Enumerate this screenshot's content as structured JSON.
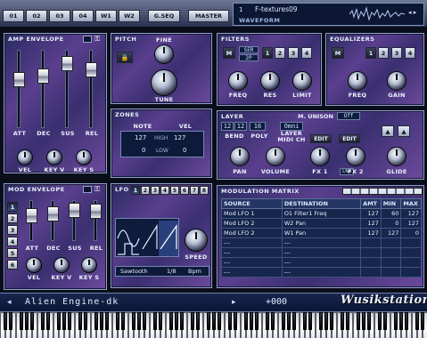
{
  "top_tabs": [
    "01",
    "02",
    "03",
    "04",
    "W1",
    "W2"
  ],
  "gseq_label": "G.SEQ",
  "master_label": "MASTER",
  "waveform": {
    "index": "1",
    "name": "F-textures09",
    "label": "WAVEFORM"
  },
  "amp_envelope": {
    "title": "AMP ENVELOPE",
    "faders": [
      "ATT",
      "DEC",
      "SUS",
      "REL"
    ],
    "levels": [
      0.35,
      0.3,
      0.1,
      0.2
    ],
    "knobs": [
      "VEL",
      "KEY V",
      "KEY S"
    ]
  },
  "pitch": {
    "title": "PITCH",
    "fine": "FINE",
    "tune": "TUNE"
  },
  "filters": {
    "title": "FILTERS",
    "mode1": "SER",
    "mode2": "2P",
    "slots": [
      "2",
      "3",
      "4"
    ],
    "knobs": [
      "FREQ",
      "RES",
      "LIMIT"
    ]
  },
  "equalizers": {
    "title": "EQUALIZERS",
    "slots": [
      "2",
      "3",
      "4"
    ],
    "knobs": [
      "FREQ",
      "GAIN"
    ]
  },
  "zones": {
    "title": "ZONES",
    "note": "NOTE",
    "vel": "VEL",
    "high_label": "HIGH",
    "low_label": "LOW",
    "note_high": "127",
    "note_low": "0",
    "vel_high": "127",
    "vel_low": "0"
  },
  "layer": {
    "title": "LAYER",
    "bend_up": "12",
    "bend_down": "12",
    "poly": "16",
    "midi_ch": "Omni",
    "unison_label": "M. UNISON",
    "unison_value": "Off",
    "bend_label": "BEND",
    "poly_label": "POLY",
    "midich_label": "LAYER\nMIDI CH",
    "edit": "EDIT",
    "knobs": [
      "PAN",
      "VOLUME",
      "FX 1",
      "FX 2",
      "GLIDE"
    ],
    "fx_link": "LNK"
  },
  "mod_envelope": {
    "title": "MOD ENVELOPE",
    "numbers": [
      "1",
      "2",
      "3",
      "4",
      "5",
      "6"
    ],
    "faders": [
      "ATT",
      "DEC",
      "SUS",
      "REL"
    ],
    "levels": [
      0.3,
      0.25,
      0.1,
      0.15
    ],
    "knobs": [
      "VEL",
      "KEY V",
      "KEY S"
    ]
  },
  "lfo": {
    "title": "LFO",
    "numbers": [
      "1",
      "2",
      "3",
      "4",
      "5",
      "6",
      "7",
      "8"
    ],
    "wave_name": "Sawtooth",
    "rate": "1/8",
    "unit": "Bpm",
    "speed_label": "SPEED"
  },
  "mod_matrix": {
    "title": "MODULATION MATRIX",
    "columns": [
      "SOURCE",
      "DESTINATION",
      "AMT",
      "MIN",
      "MAX"
    ],
    "rows": [
      [
        "Mod LFO 1",
        "O1 Filter1 Freq",
        "127",
        "60",
        "127"
      ],
      [
        "Mod LFO 2",
        "W2 Pan",
        "127",
        "0",
        "127"
      ],
      [
        "Mod LFO 2",
        "W1 Pan",
        "127",
        "127",
        "0"
      ],
      [
        "---",
        "---",
        "",
        "",
        ""
      ],
      [
        "---",
        "---",
        "",
        "",
        ""
      ],
      [
        "---",
        "---",
        "",
        "",
        ""
      ],
      [
        "---",
        "---",
        "",
        "",
        ""
      ]
    ]
  },
  "preset": {
    "name": "Alien Engine-dk",
    "value": "+000"
  },
  "logo": "Wusikstation"
}
